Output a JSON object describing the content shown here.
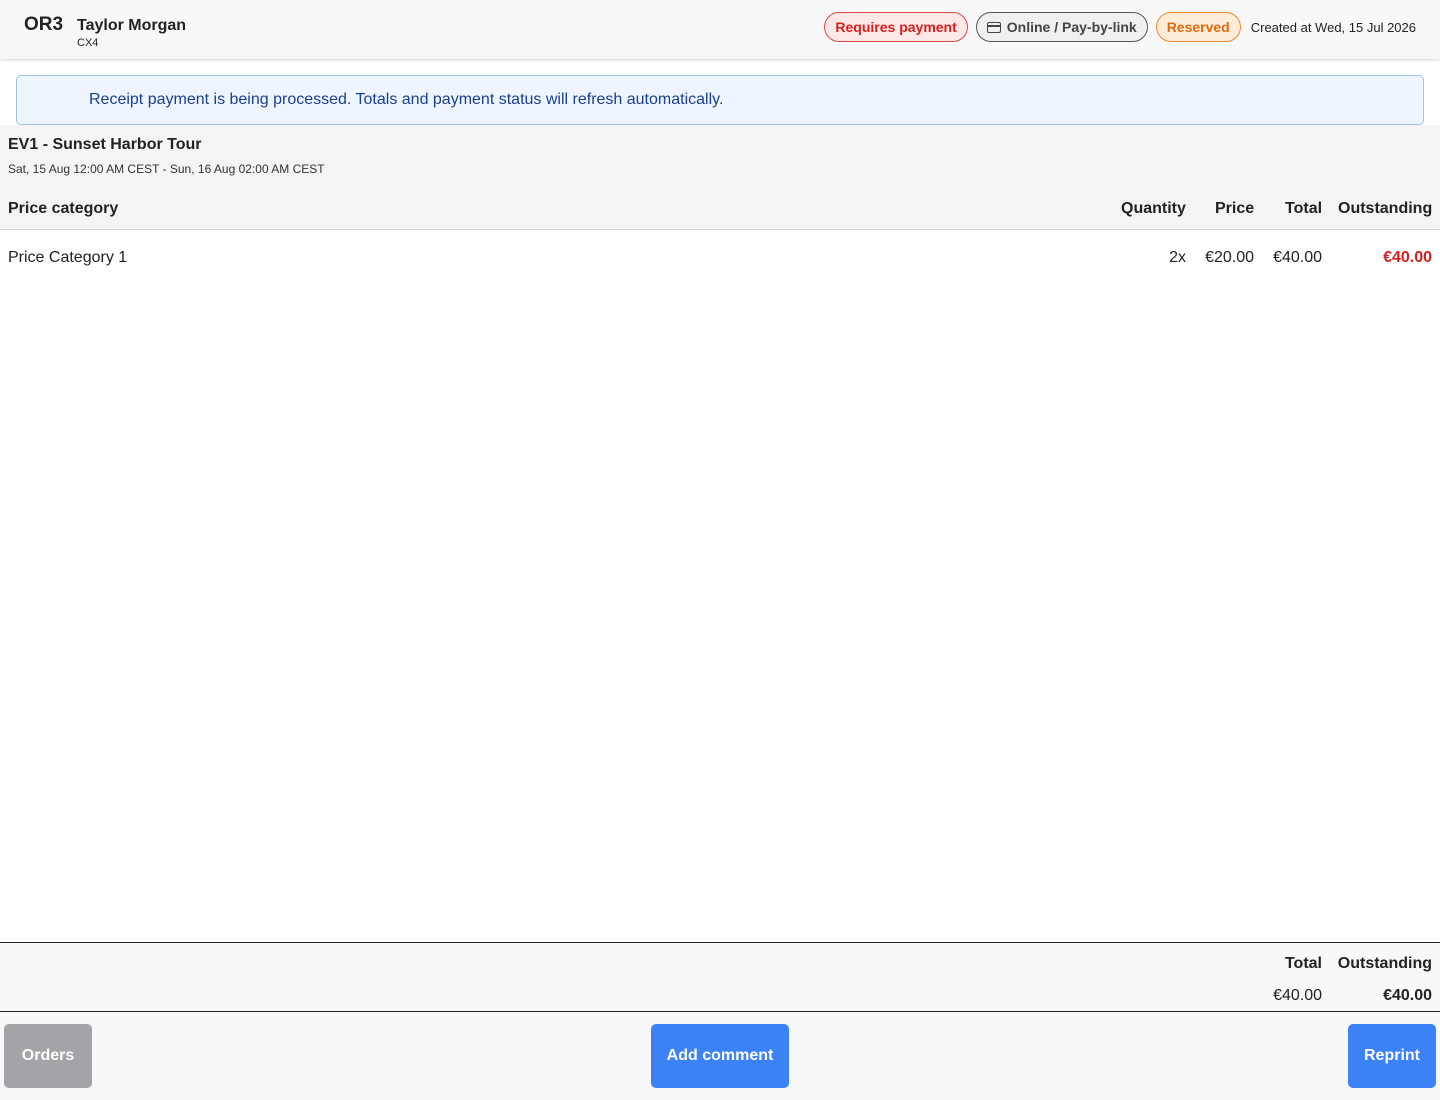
{
  "header": {
    "order_id": "OR3",
    "customer_name": "Taylor Morgan",
    "customer_code": "CX4",
    "status_payment": "Requires payment",
    "payment_method": "Online / Pay-by-link",
    "status_reservation": "Reserved",
    "created": "Created at Wed, 15 Jul 2026",
    "payment_method_icon": "credit-card-icon"
  },
  "notice": {
    "text": "Receipt payment is being processed. Totals and payment status will refresh automatically."
  },
  "event": {
    "title": "EV1 - Sunset Harbor Tour",
    "dates": "Sat, 15 Aug 12:00 AM CEST - Sun, 16 Aug 02:00 AM CEST",
    "columns": {
      "category": "Price category",
      "quantity": "Quantity",
      "price": "Price",
      "total": "Total",
      "outstanding": "Outstanding"
    },
    "rows": [
      {
        "category": "Price Category 1",
        "quantity": "2x",
        "price": "€20.00",
        "total": "€40.00",
        "outstanding": "€40.00"
      }
    ]
  },
  "totals": {
    "total_label": "Total",
    "outstanding_label": "Outstanding",
    "total_value": "€40.00",
    "outstanding_value": "€40.00"
  },
  "footer": {
    "orders_label": "Orders",
    "comment_label": "Add comment",
    "reprint_label": "Reprint"
  },
  "colors": {
    "accent_blue": "#3b82f6",
    "danger_red": "#d42020",
    "warning_orange": "#e06a10"
  }
}
